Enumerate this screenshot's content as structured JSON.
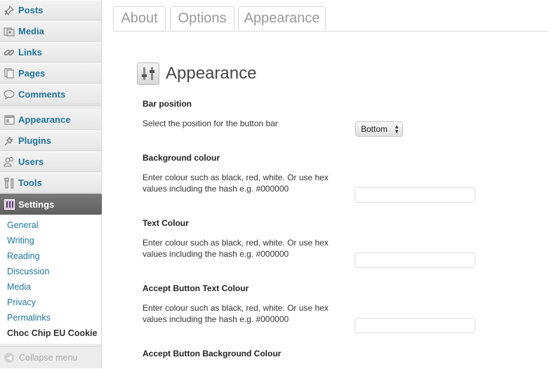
{
  "sidebar": {
    "items": [
      {
        "label": "Posts",
        "icon": "pushpin-icon"
      },
      {
        "label": "Media",
        "icon": "media-icon"
      },
      {
        "label": "Links",
        "icon": "link-icon"
      },
      {
        "label": "Pages",
        "icon": "pages-icon"
      },
      {
        "label": "Comments",
        "icon": "comment-icon"
      },
      {
        "label": "Appearance",
        "icon": "appearance-icon"
      },
      {
        "label": "Plugins",
        "icon": "plugin-icon"
      },
      {
        "label": "Users",
        "icon": "users-icon"
      },
      {
        "label": "Tools",
        "icon": "tools-icon"
      }
    ],
    "settings": {
      "label": "Settings",
      "icon": "settings-icon"
    },
    "submenu": [
      "General",
      "Writing",
      "Reading",
      "Discussion",
      "Media",
      "Privacy",
      "Permalinks",
      "Choc Chip EU Cookie"
    ],
    "collapse_label": "Collapse menu"
  },
  "tabs": [
    "About",
    "Options",
    "Appearance"
  ],
  "page_title": "Appearance",
  "fields": [
    {
      "label": "Bar position",
      "description": "Select the position for the button bar",
      "type": "select",
      "value": "Bottom"
    },
    {
      "label": "Background colour",
      "description": "Enter colour such as black, red, white. Or use hex values including the hash e.g. #000000",
      "type": "text",
      "value": ""
    },
    {
      "label": "Text Colour",
      "description": "Enter colour such as black, red, white. Or use hex values including the hash e.g. #000000",
      "type": "text",
      "value": ""
    },
    {
      "label": "Accept Button Text Colour",
      "description": "Enter colour such as black, red, white. Or use hex values including the hash e.g. #000000",
      "type": "text",
      "value": ""
    },
    {
      "label": "Accept Button Background Colour"
    }
  ],
  "colors": {
    "link": "#21759b",
    "settings_bg": "#636363",
    "sidebar_bg": "#ececec"
  }
}
